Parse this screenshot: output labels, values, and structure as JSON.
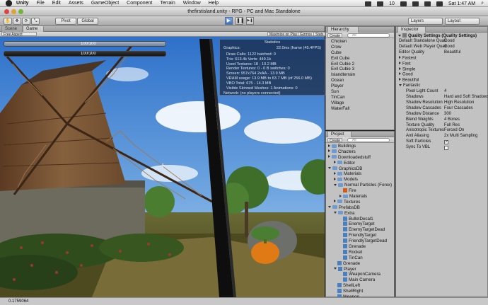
{
  "menubar": {
    "app": "Unity",
    "items": [
      "File",
      "Edit",
      "Assets",
      "GameObject",
      "Component",
      "Terrain",
      "Window",
      "Help"
    ],
    "battery_count": "10",
    "clock": "Sat 1:47 AM"
  },
  "window_title": "thefirstisland.unity - RPG - PC and Mac Standalone",
  "toolbar": {
    "pivot": "Pivot",
    "global": "Global",
    "play": "▶",
    "pause": "❚❚",
    "step": "▶❚",
    "layers": "Layers",
    "layout": "Layout"
  },
  "scene_tabs": {
    "scene": "Scene",
    "game": "Game",
    "aspect": "Free Aspect",
    "maximize": "Maximize on Play",
    "gizmos": "Gizmos",
    "stats": "Stats"
  },
  "hud": {
    "health_text": "100/100",
    "mana_text": "100/100",
    "health_fraction": 1.0,
    "mana_fraction": 1.0
  },
  "statistics": {
    "title": "Statistics",
    "graphics_label": "Graphics:",
    "fps": "22.0ms (frame (45.4FPS)",
    "lines": [
      "Draw Calls: 1122    batched: 0",
      "Tris: 613.4k    Verts: 449.1k",
      "Used Textures: 18 - 10.2 MB",
      "Render Textures: 0 - 0 B   switches: 0",
      "Screen: 957x764 2xAA - 13.9 MB",
      "VRAM usage: 13.9 MB to 63.7 MB (of 256.0 MB)",
      "VBO Total: 675 - 14.3 MB",
      "Visible Skinned Meshes: 1    Animations: 0"
    ],
    "network": "Network: (no players connected)"
  },
  "hierarchy": {
    "title": "Hierarchy",
    "create": "Create",
    "search_placeholder": "All",
    "items": [
      {
        "label": "Chicken",
        "arrow": false
      },
      {
        "label": "Crow",
        "arrow": false
      },
      {
        "label": "Cube",
        "arrow": false
      },
      {
        "label": "Evil Cube",
        "arrow": false
      },
      {
        "label": "Evil Cubie 2",
        "arrow": false
      },
      {
        "label": "Evil Cubie 3",
        "arrow": false
      },
      {
        "label": "Islandterrain",
        "arrow": false
      },
      {
        "label": "Ocean",
        "arrow": false
      },
      {
        "label": "Player",
        "arrow": true
      },
      {
        "label": "Sun",
        "arrow": false
      },
      {
        "label": "TinCan",
        "arrow": false
      },
      {
        "label": "Village",
        "arrow": true
      },
      {
        "label": "WaterFall",
        "arrow": false
      }
    ]
  },
  "project": {
    "title": "Project",
    "create": "Create",
    "search_placeholder": "All",
    "items": [
      {
        "label": "Buildings",
        "indent": 0,
        "open": false,
        "kind": "folder"
      },
      {
        "label": "Chacters",
        "indent": 0,
        "open": false,
        "kind": "folder"
      },
      {
        "label": "Downloadedstuff",
        "indent": 0,
        "open": false,
        "kind": "folder"
      },
      {
        "label": "Editor",
        "indent": 1,
        "open": false,
        "kind": "folder"
      },
      {
        "label": "GraphicsDB",
        "indent": 0,
        "open": true,
        "kind": "folder"
      },
      {
        "label": "Materials",
        "indent": 1,
        "open": false,
        "kind": "folder"
      },
      {
        "label": "Models",
        "indent": 1,
        "open": false,
        "kind": "folder"
      },
      {
        "label": "Normal Particles (Forex)",
        "indent": 1,
        "open": true,
        "kind": "folder"
      },
      {
        "label": "Fire",
        "indent": 2,
        "open": false,
        "kind": "asset"
      },
      {
        "label": "Materials",
        "indent": 2,
        "open": false,
        "kind": "folder"
      },
      {
        "label": "Textures",
        "indent": 1,
        "open": false,
        "kind": "folder"
      },
      {
        "label": "PrefabsDB",
        "indent": 0,
        "open": true,
        "kind": "folder"
      },
      {
        "label": "Extra",
        "indent": 1,
        "open": true,
        "kind": "folder"
      },
      {
        "label": "BulletDecal1",
        "indent": 2,
        "open": false,
        "kind": "prefab"
      },
      {
        "label": "EnemyTarget",
        "indent": 2,
        "open": false,
        "kind": "prefab"
      },
      {
        "label": "EnemyTargetDead",
        "indent": 2,
        "open": false,
        "kind": "prefab"
      },
      {
        "label": "FriendlyTarget",
        "indent": 2,
        "open": false,
        "kind": "prefab"
      },
      {
        "label": "FriendlyTargetDead",
        "indent": 2,
        "open": false,
        "kind": "prefab"
      },
      {
        "label": "Grenade",
        "indent": 2,
        "open": false,
        "kind": "prefab"
      },
      {
        "label": "Rocket",
        "indent": 2,
        "open": false,
        "kind": "prefab"
      },
      {
        "label": "TinCan",
        "indent": 2,
        "open": false,
        "kind": "prefab"
      },
      {
        "label": "Grenade",
        "indent": 1,
        "open": false,
        "kind": "prefab"
      },
      {
        "label": "Player",
        "indent": 1,
        "open": true,
        "kind": "prefab"
      },
      {
        "label": "WeaponCamera",
        "indent": 2,
        "open": false,
        "kind": "prefab"
      },
      {
        "label": "Main Camera",
        "indent": 2,
        "open": false,
        "kind": "prefab"
      },
      {
        "label": "ShellLeft",
        "indent": 1,
        "open": false,
        "kind": "prefab"
      },
      {
        "label": "ShellRight",
        "indent": 1,
        "open": false,
        "kind": "prefab"
      },
      {
        "label": "Weapon",
        "indent": 1,
        "open": false,
        "kind": "prefab"
      }
    ]
  },
  "inspector": {
    "title": "Inspector",
    "header": "Quality Settings",
    "header_sub": "(Quality Settings)",
    "defaults": [
      {
        "label": "Default Standalone Quali",
        "value": "Good"
      },
      {
        "label": "Default Web Player Quali",
        "value": "Good"
      },
      {
        "label": "Editor Quality",
        "value": "Beautiful"
      }
    ],
    "levels": [
      "Fastest",
      "Fast",
      "Simple",
      "Good",
      "Beautiful",
      "Fantastic"
    ],
    "settings": [
      {
        "label": "Pixel Light Count",
        "value": "4"
      },
      {
        "label": "Shadows",
        "value": "Hard and Soft Shadows"
      },
      {
        "label": "Shadow Resolution",
        "value": "High Resolution"
      },
      {
        "label": "Shadow Cascades",
        "value": "Four Cascades"
      },
      {
        "label": "Shadow Distance",
        "value": "300"
      },
      {
        "label": "Blend Weights",
        "value": "4 Bones"
      },
      {
        "label": "Texture Quality",
        "value": "Full Res"
      },
      {
        "label": "Anisotropic Textures",
        "value": "Forced On"
      },
      {
        "label": "Anti Aliasing",
        "value": "2x Multi Sampling"
      }
    ],
    "soft_particles_label": "Soft Particles",
    "soft_particles": true,
    "vbl_label": "Sync To VBL",
    "vbl": false
  },
  "status": {
    "text": "0.1759064"
  }
}
